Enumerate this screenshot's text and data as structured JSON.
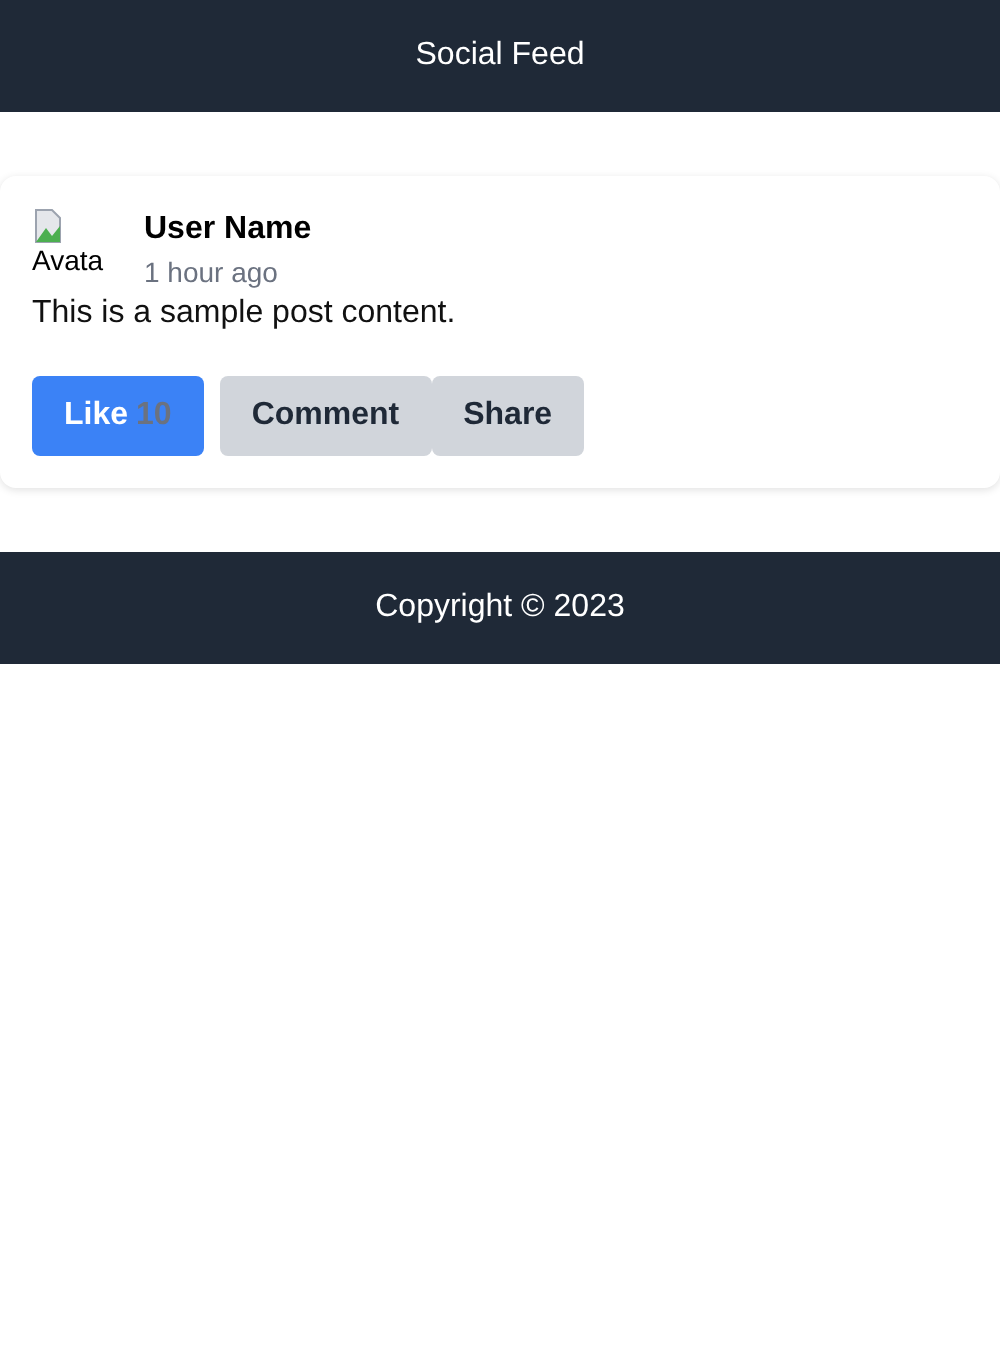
{
  "header": {
    "title": "Social Feed"
  },
  "post": {
    "avatar_alt": "Avata",
    "user_name": "User Name",
    "time": "1 hour ago",
    "content": "This is a sample post content.",
    "actions": [
      {
        "kind": "like",
        "label": "Like",
        "count": "10",
        "selected": true
      },
      {
        "kind": "plain",
        "label": "Comment"
      },
      {
        "kind": "plain",
        "label": "Share"
      }
    ]
  },
  "footer": {
    "text": "Copyright © 2023"
  }
}
